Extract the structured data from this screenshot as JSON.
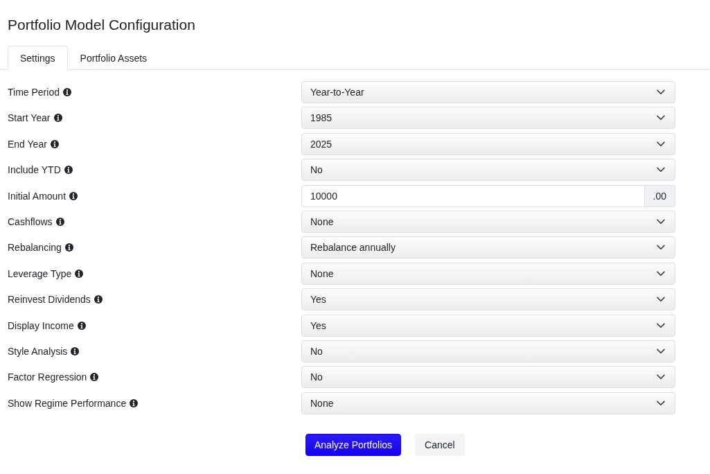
{
  "title": "Portfolio Model Configuration",
  "tabs": [
    {
      "label": "Settings",
      "selected": true
    },
    {
      "label": "Portfolio Assets",
      "selected": false
    }
  ],
  "fields": [
    {
      "label": "Time Period",
      "kind": "select",
      "value": "Year-to-Year"
    },
    {
      "label": "Start Year",
      "kind": "select",
      "value": "1985"
    },
    {
      "label": "End Year",
      "kind": "select",
      "value": "2025"
    },
    {
      "label": "Include YTD",
      "kind": "select",
      "value": "No"
    },
    {
      "label": "Initial Amount",
      "kind": "input",
      "value": "10000",
      "addon": ".00"
    },
    {
      "label": "Cashflows",
      "kind": "select",
      "value": "None"
    },
    {
      "label": "Rebalancing",
      "kind": "select",
      "value": "Rebalance annually"
    },
    {
      "label": "Leverage Type",
      "kind": "select",
      "value": "None"
    },
    {
      "label": "Reinvest Dividends",
      "kind": "select",
      "value": "Yes"
    },
    {
      "label": "Display Income",
      "kind": "select",
      "value": "Yes"
    },
    {
      "label": "Style Analysis",
      "kind": "select",
      "value": "No"
    },
    {
      "label": "Factor Regression",
      "kind": "select",
      "value": "No"
    },
    {
      "label": "Show Regime Performance",
      "kind": "select",
      "value": "None"
    }
  ],
  "buttons": [
    {
      "label": "Analyze Portfolios",
      "kind": "primary"
    },
    {
      "label": "Cancel",
      "kind": "secondary"
    }
  ]
}
